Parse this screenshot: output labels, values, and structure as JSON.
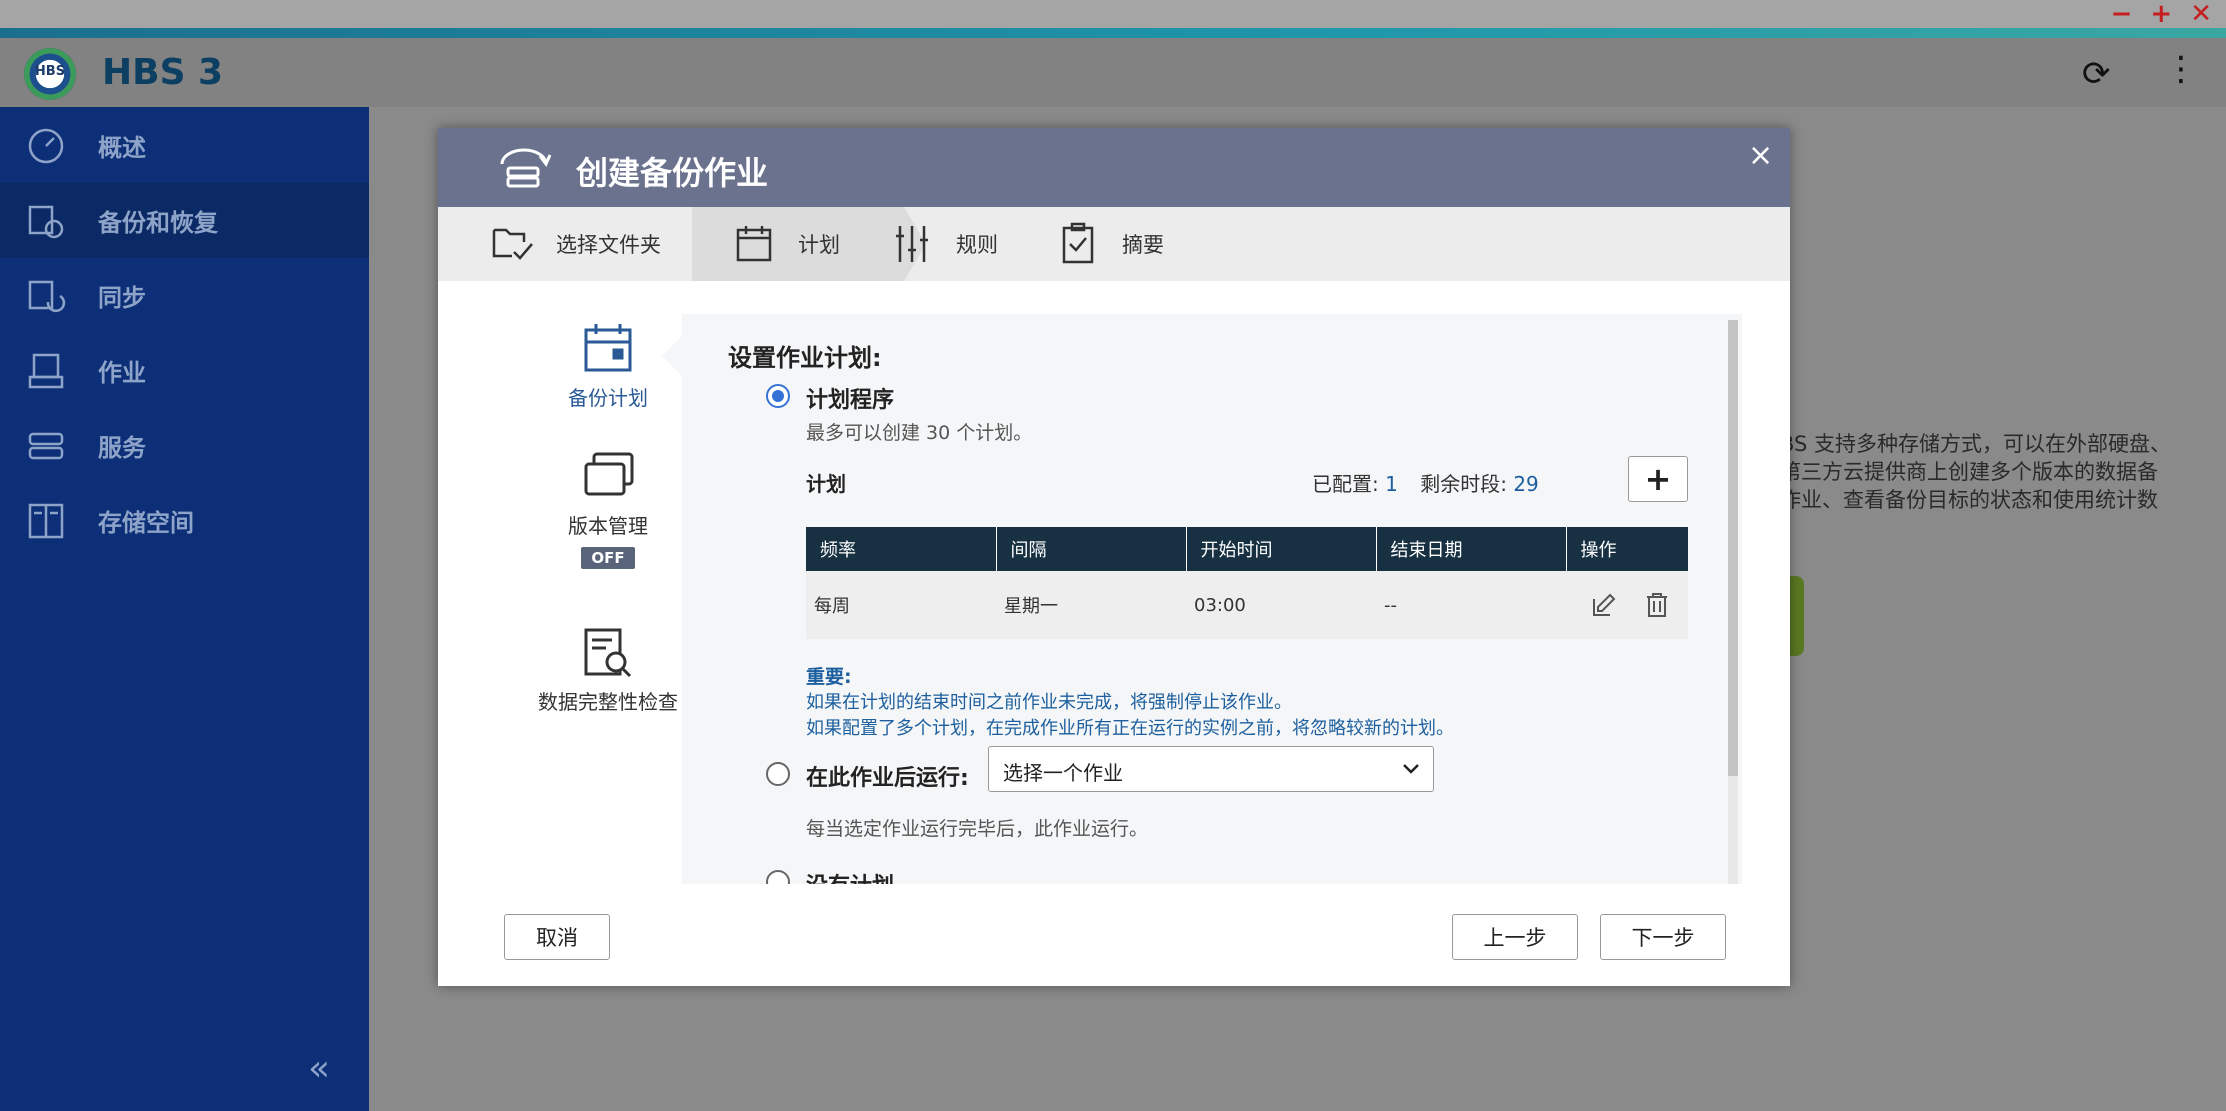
{
  "app": {
    "title": "HBS 3",
    "logo_text": "HBS"
  },
  "chrome": {
    "min": "−",
    "max": "+",
    "close": "✕"
  },
  "header": {
    "refresh_icon": "refresh-icon",
    "menu_icon": "kebab-icon"
  },
  "sidebar": {
    "items": [
      {
        "label": "概述",
        "icon": "gauge-icon"
      },
      {
        "label": "备份和恢复",
        "icon": "backup-restore-icon",
        "active": true
      },
      {
        "label": "同步",
        "icon": "sync-icon"
      },
      {
        "label": "作业",
        "icon": "job-icon"
      },
      {
        "label": "服务",
        "icon": "service-icon"
      },
      {
        "label": "存储空间",
        "icon": "storage-icon"
      }
    ],
    "collapse": "«"
  },
  "background": {
    "text_lines": [
      "BS 支持多种存储方式，可以在外部硬盘、",
      "第三方云提供商上创建多个版本的数据备",
      "作业、查看备份目标的状态和使用统计数"
    ]
  },
  "dialog": {
    "title": "创建备份作业",
    "close": "×",
    "steps": [
      "选择文件夹",
      "计划",
      "规则",
      "摘要"
    ],
    "inner_nav": [
      {
        "label": "备份计划"
      },
      {
        "label": "版本管理",
        "badge": "OFF"
      },
      {
        "label": "数据完整性检查"
      }
    ],
    "section_title": "设置作业计划:",
    "opt1": {
      "label": "计划程序",
      "desc": "最多可以创建 30 个计划。"
    },
    "plan": {
      "title": "计划",
      "configured_label": "已配置:",
      "configured_value": "1",
      "remaining_label": "剩余时段:",
      "remaining_value": "29",
      "add": "+",
      "columns": [
        "频率",
        "间隔",
        "开始时间",
        "结束日期",
        "操作"
      ],
      "rows": [
        {
          "freq": "每周",
          "interval": "星期一",
          "start": "03:00",
          "end": "--"
        }
      ]
    },
    "important": {
      "title": "重要:",
      "line1": "如果在计划的结束时间之前作业未完成，将强制停止该作业。",
      "line2": "如果配置了多个计划，在完成作业所有正在运行的实例之前，将忽略较新的计划。"
    },
    "opt2": {
      "label": "在此作业后运行:",
      "select_value": "选择一个作业",
      "desc": "每当选定作业运行完毕后，此作业运行。"
    },
    "opt3": {
      "label": "没有计划"
    },
    "buttons": {
      "cancel": "取消",
      "prev": "上一步",
      "next": "下一步"
    },
    "colors": {
      "accent": "#3472d6",
      "header": "#6a728d",
      "table_head": "#173042",
      "important": "#1d5f9e"
    }
  }
}
